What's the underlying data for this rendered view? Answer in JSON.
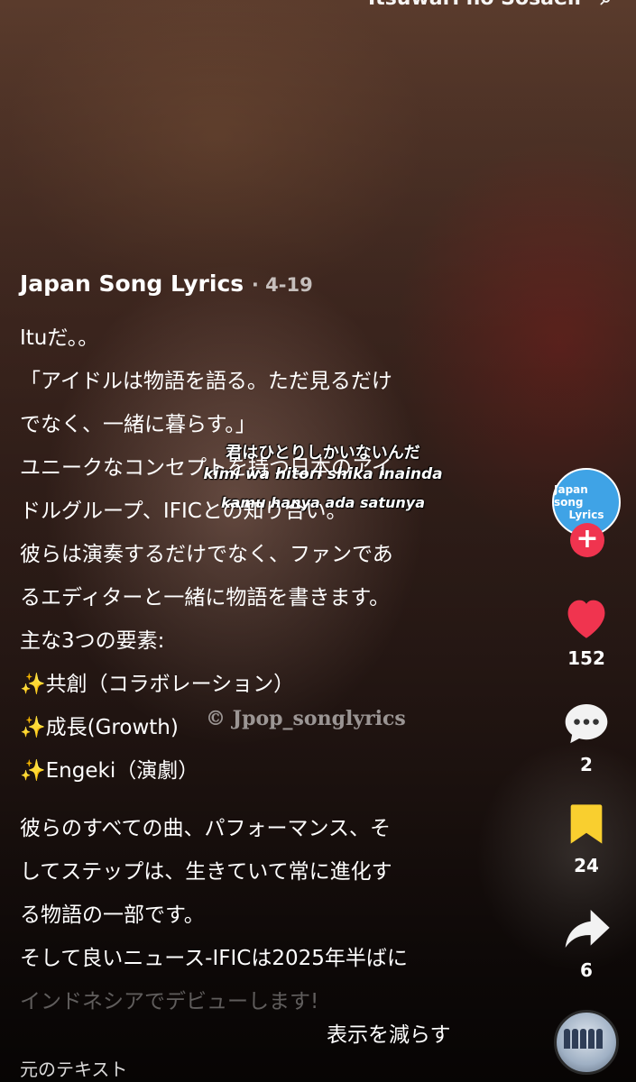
{
  "top_search": {
    "text": "Itsuwari no Sosaeli",
    "icon": "search-icon"
  },
  "video": {
    "subtitles": [
      "君はひとりしかいないんだ",
      "kimi wa hitori shika inainda",
      "kamu hanya ada satunya"
    ],
    "watermark": "© Jpop_songlyrics"
  },
  "post": {
    "author": "Japan Song Lyrics",
    "date": "4-19",
    "lines": [
      "Ituだ。。",
      "「アイドルは物語を語る。ただ見るだけ",
      "でなく、一緒に暮らす。」",
      "ユニークなコンセプトを持つ日本のアイ",
      "ドルグループ、IFICとの知り合い。",
      "彼らは演奏するだけでなく、ファンであ",
      "るエディターと一緒に物語を書きます。",
      "主な3つの要素:",
      "✨共創（コラボレーション）",
      "✨成長(Growth)",
      "✨Engeki（演劇）"
    ],
    "lines2": [
      "彼らのすべての曲、パフォーマンス、そ",
      "してステップは、生きていて常に進化す",
      "る物語の一部です。",
      "そして良いニュース-IFICは2025年半ばに",
      "インドネシアでデビューします!"
    ],
    "show_less": "表示を減らす",
    "original_text": "元のテキスト"
  },
  "rail": {
    "avatar_line1": "Japan song",
    "avatar_line2": "Lyrics",
    "likes": "152",
    "comments": "2",
    "saves": "24",
    "shares": "6",
    "colors": {
      "like": "#f0344f",
      "save": "#f9cf2f",
      "follow": "#f0344f",
      "avatar": "#3fa3e6"
    }
  }
}
